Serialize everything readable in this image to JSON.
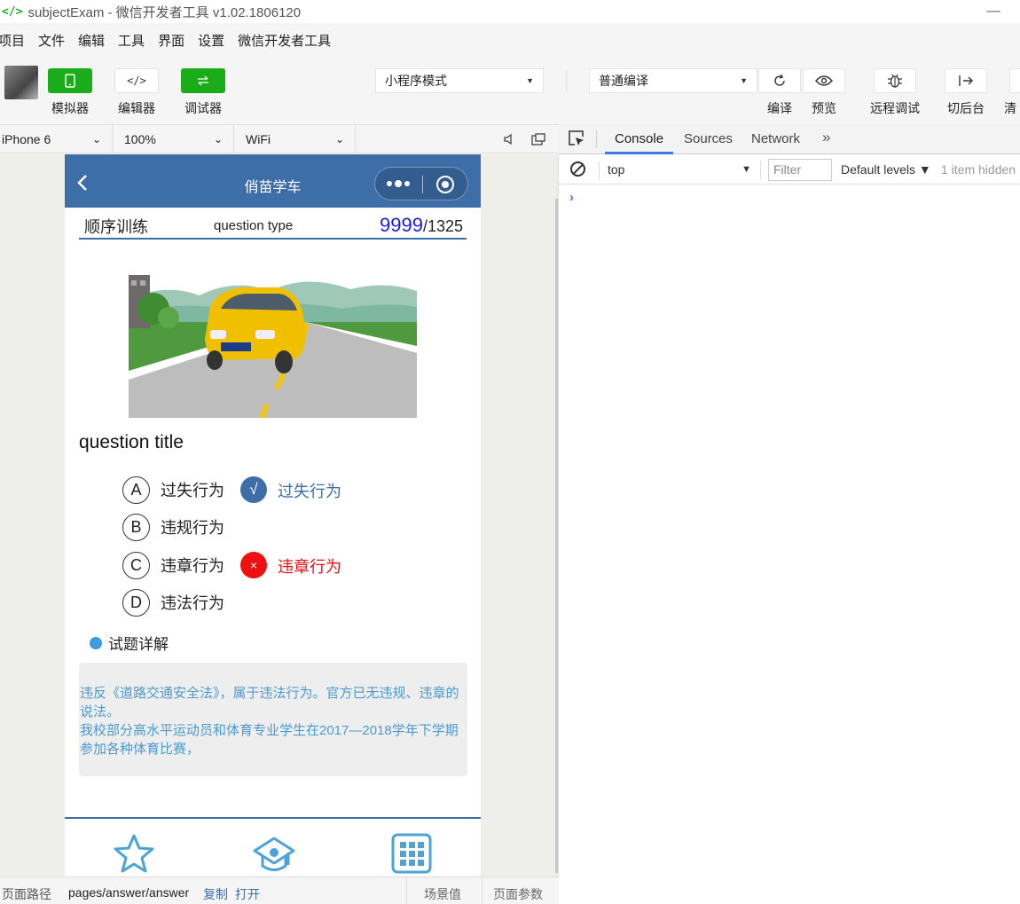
{
  "window": {
    "title": "subjectExam - 微信开发者工具 v1.02.1806120",
    "minimize": "—"
  },
  "menu": [
    "项目",
    "文件",
    "编辑",
    "工具",
    "界面",
    "设置",
    "微信开发者工具"
  ],
  "toolbar": {
    "simulator_label": "模拟器",
    "editor_label": "编辑器",
    "debugger_label": "调试器",
    "mode_select": "小程序模式",
    "compile_select": "普通编译",
    "compile_label": "编译",
    "preview_label": "预览",
    "remote_debug_label": "远程调试",
    "background_label": "切后台",
    "clear_cache_label": "清"
  },
  "device_bar": {
    "device": "iPhone 6",
    "zoom": "100%",
    "network": "WiFi"
  },
  "phone": {
    "nav_title": "俏苗学车",
    "header": {
      "mode": "顺序训练",
      "question_type": "question type",
      "current": "9999",
      "total": "/1325"
    },
    "question_title": "question title",
    "options": [
      {
        "letter": "A",
        "text": "过失行为"
      },
      {
        "letter": "B",
        "text": "违规行为"
      },
      {
        "letter": "C",
        "text": "违章行为"
      },
      {
        "letter": "D",
        "text": "违法行为"
      }
    ],
    "correct_answer": {
      "mark": "√",
      "text": "过失行为"
    },
    "wrong_answer": {
      "mark": "×",
      "text": "违章行为"
    },
    "detail_label": "试题详解",
    "explanation": "违反《道路交通安全法》，属于违法行为。官方已无违规、违章的说法。\n我校部分高水平运动员和体育专业学生在2017—2018学年下学期参加各种体育比赛，",
    "colors": {
      "primary": "#3d6ea8",
      "wrong": "#ee1111",
      "count": "#1a1aee",
      "explain_text": "#4b9ad0"
    }
  },
  "devtools": {
    "tabs": [
      "Console",
      "Sources",
      "Network"
    ],
    "active_tab": "Console",
    "context": "top",
    "filter_placeholder": "Filter",
    "levels": "Default levels ▼",
    "hidden": "1 item hidden"
  },
  "statusbar": {
    "path_label": "页面路径",
    "path": "pages/answer/answer",
    "copy": "复制",
    "open": "打开",
    "scene": "场景值",
    "params": "页面参数"
  }
}
